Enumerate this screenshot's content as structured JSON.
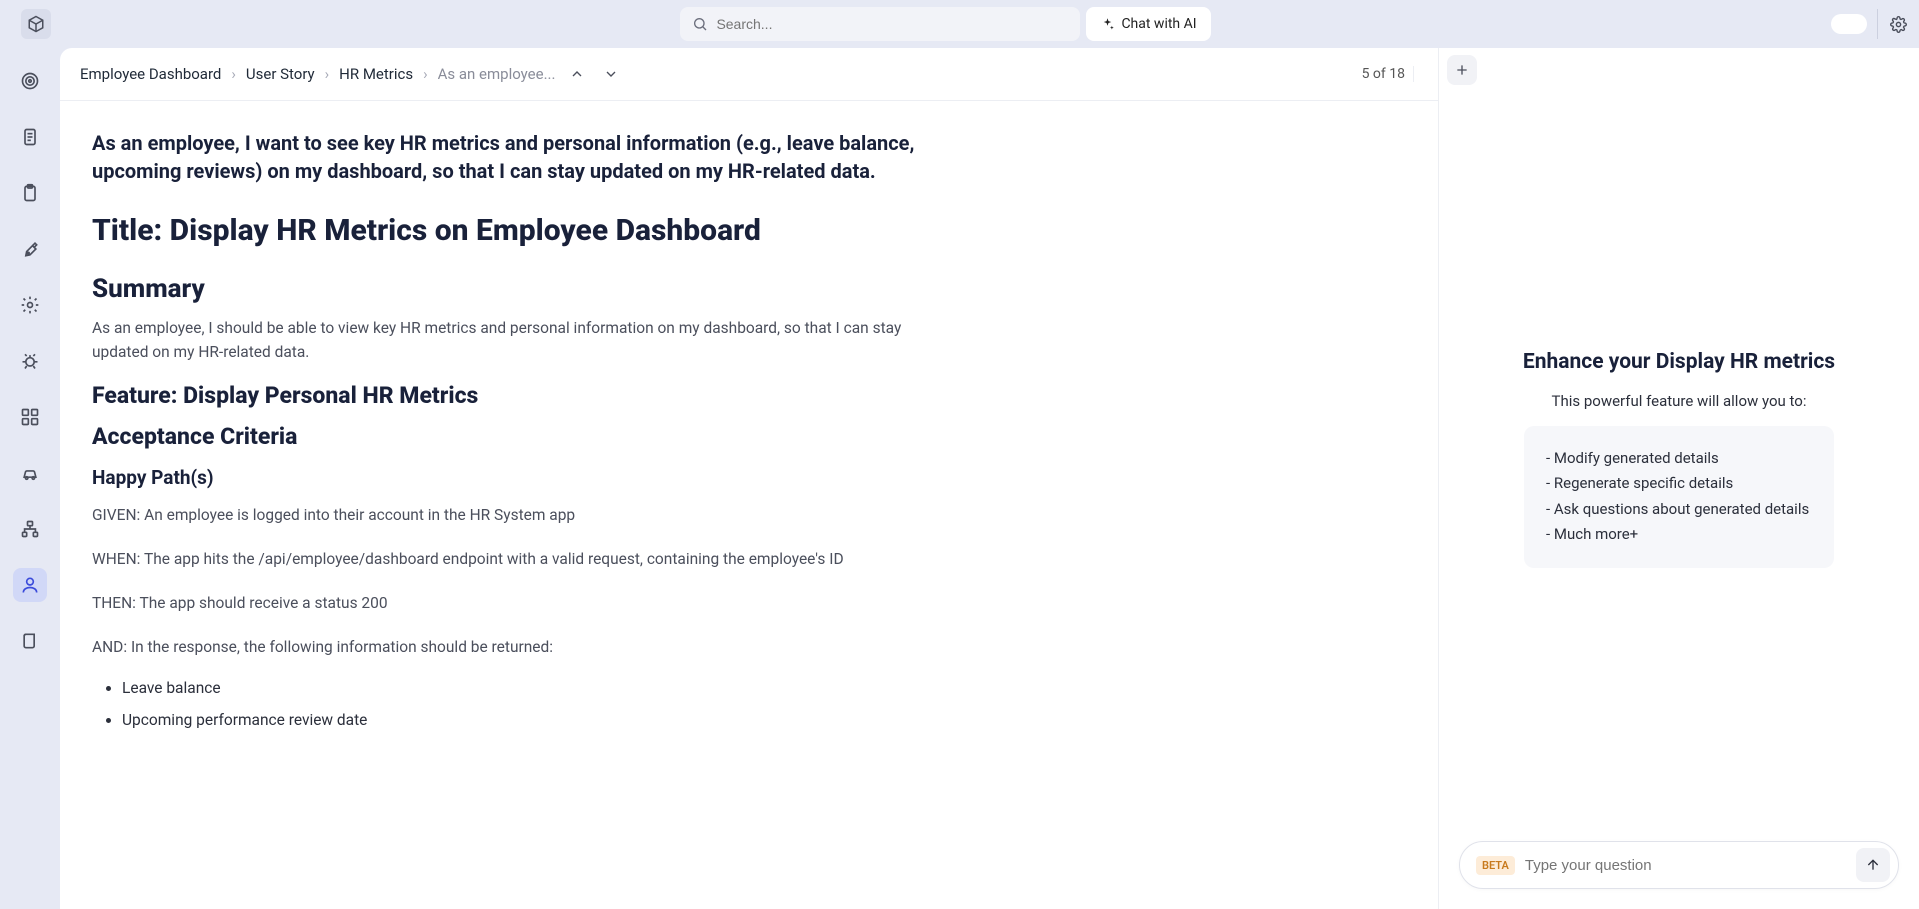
{
  "topbar": {
    "search_placeholder": "Search...",
    "chat_ai_label": "Chat with AI"
  },
  "breadcrumbs": {
    "items": [
      "Employee Dashboard",
      "User Story",
      "HR Metrics",
      "As an employee..."
    ],
    "page_indicator": "5 of 18"
  },
  "document": {
    "lead": "As an employee, I want to see key HR metrics and personal information (e.g., leave balance, upcoming reviews) on my dashboard, so that I can stay updated on my HR-related data.",
    "title_line": "Title: Display HR Metrics on Employee Dashboard",
    "summary_heading": "Summary",
    "summary_text": "As an employee, I should be able to view key HR metrics and personal information on my dashboard, so that I can stay updated on my HR-related data.",
    "feature_heading": "Feature: Display Personal HR Metrics",
    "acceptance_heading": "Acceptance Criteria",
    "happy_heading": "Happy Path(s)",
    "steps": [
      "GIVEN: An employee is logged into their account in the HR System app",
      "WHEN: The app hits the /api/employee/dashboard endpoint with a valid request, containing the employee's ID",
      "THEN: The app should receive a status 200",
      "AND: In the response, the following information should be returned:"
    ],
    "bullets": [
      "Leave balance",
      "Upcoming performance review date"
    ]
  },
  "right_panel": {
    "title": "Enhance your Display HR metrics",
    "subtitle": "This powerful feature will allow you to:",
    "points": [
      "- Modify generated details",
      "- Regenerate specific details",
      "- Ask questions about generated details",
      "- Much more+"
    ],
    "beta_label": "BETA",
    "input_placeholder": "Type your question"
  }
}
